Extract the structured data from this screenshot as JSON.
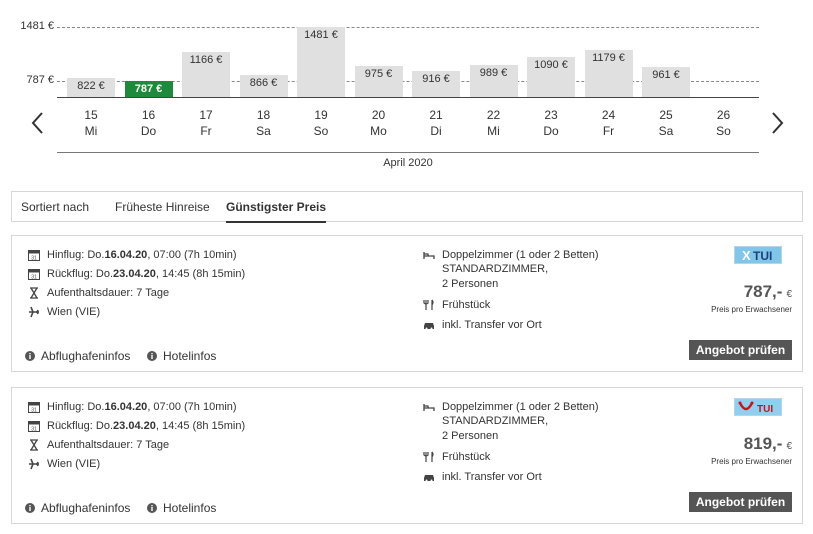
{
  "chart": {
    "max_label": "1481 €",
    "ref_label": "787 €",
    "month_label": "April 2020",
    "selected_index": 1,
    "days": [
      {
        "date": "15",
        "weekday": "Mi",
        "price": 822,
        "label": "822 €"
      },
      {
        "date": "16",
        "weekday": "Do",
        "price": 787,
        "label": "787 €"
      },
      {
        "date": "17",
        "weekday": "Fr",
        "price": 1166,
        "label": "1166 €"
      },
      {
        "date": "18",
        "weekday": "Sa",
        "price": 866,
        "label": "866 €"
      },
      {
        "date": "19",
        "weekday": "So",
        "price": 1481,
        "label": "1481 €"
      },
      {
        "date": "20",
        "weekday": "Mo",
        "price": 975,
        "label": "975 €"
      },
      {
        "date": "21",
        "weekday": "Di",
        "price": 916,
        "label": "916 €"
      },
      {
        "date": "22",
        "weekday": "Mi",
        "price": 989,
        "label": "989 €"
      },
      {
        "date": "23",
        "weekday": "Do",
        "price": 1090,
        "label": "1090 €"
      },
      {
        "date": "24",
        "weekday": "Fr",
        "price": 1179,
        "label": "1179 €"
      },
      {
        "date": "25",
        "weekday": "Sa",
        "price": 961,
        "label": "961 €"
      },
      {
        "date": "26",
        "weekday": "So",
        "price": null,
        "label": ""
      }
    ],
    "colors": {
      "bar": "#e0e0e0",
      "selected": "#1f8a3b"
    },
    "prev_icon": "chevron-left-icon",
    "next_icon": "chevron-right-icon"
  },
  "sort": {
    "label": "Sortiert nach",
    "options": [
      "Früheste Hinreise",
      "Günstigster Preis"
    ],
    "active": "Günstigster Preis"
  },
  "offers": [
    {
      "outbound_prefix": "Hinflug: Do. ",
      "outbound_date": "16.04.20",
      "outbound_rest": ", 07:00 (7h 10min)",
      "return_prefix": "Rückflug: Do. ",
      "return_date": "23.04.20",
      "return_rest": ", 14:45 (8h 15min)",
      "stay": "Aufenthaltsdauer: 7 Tage",
      "airport": "Wien (VIE)",
      "room": "Doppelzimmer (1 oder 2 Betten)",
      "room_type": "STANDARDZIMMER,",
      "persons": "2 Personen",
      "board": "Frühstück",
      "transfer": "inkl. Transfer vor Ort",
      "logo_text": "TUI",
      "logo_style": "xtui",
      "price": "787,-",
      "currency": "€",
      "price_note": "Preis pro Erwachsener",
      "airport_info": "Abflughafeninfos",
      "hotel_info": "Hotelinfos",
      "cta": "Angebot prüfen"
    },
    {
      "outbound_prefix": "Hinflug: Do. ",
      "outbound_date": "16.04.20",
      "outbound_rest": ", 07:00 (7h 10min)",
      "return_prefix": "Rückflug: Do. ",
      "return_date": "23.04.20",
      "return_rest": ", 14:45 (8h 15min)",
      "stay": "Aufenthaltsdauer: 7 Tage",
      "airport": "Wien (VIE)",
      "room": "Doppelzimmer (1 oder 2 Betten)",
      "room_type": "STANDARDZIMMER,",
      "persons": "2 Personen",
      "board": "Frühstück",
      "transfer": "inkl. Transfer vor Ort",
      "logo_text": "TUI",
      "logo_style": "tui",
      "price": "819,-",
      "currency": "€",
      "price_note": "Preis pro Erwachsener",
      "airport_info": "Abflughafeninfos",
      "hotel_info": "Hotelinfos",
      "cta": "Angebot prüfen"
    }
  ]
}
